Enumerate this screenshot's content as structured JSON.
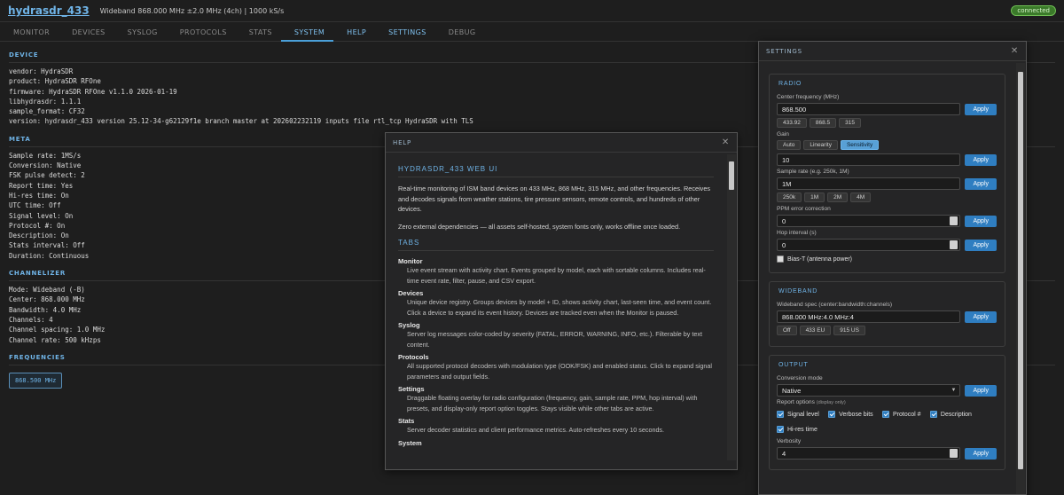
{
  "header": {
    "brand": "hydrasdr_433",
    "subtitle": "Wideband 868.000 MHz ±2.0 MHz (4ch) | 1000 kS/s",
    "status": "connected"
  },
  "tabs": [
    "MONITOR",
    "DEVICES",
    "SYSLOG",
    "PROTOCOLS",
    "STATS",
    "SYSTEM",
    "HELP",
    "SETTINGS",
    "DEBUG"
  ],
  "active_tab": "SYSTEM",
  "system": {
    "device_title": "DEVICE",
    "device": [
      "vendor: HydraSDR",
      "product: HydraSDR RFOne",
      "firmware: HydraSDR RFOne v1.1.0 2026-01-19",
      "libhydrasdr: 1.1.1",
      "sample_format: CF32",
      "version: hydrasdr_433 version 25.12-34-g62129f1e branch master at 202602232119 inputs file rtl_tcp HydraSDR with TLS"
    ],
    "meta_title": "META",
    "meta": [
      "Sample rate: 1MS/s",
      "Conversion: Native",
      "FSK pulse detect: 2",
      "Report time: Yes",
      "Hi-res time: On",
      "UTC time: Off",
      "Signal level: On",
      "Protocol #: On",
      "Description: On",
      "Stats interval: Off",
      "Duration: Continuous"
    ],
    "channelizer_title": "CHANNELIZER",
    "channelizer": [
      "Mode: Wideband (-B)",
      "Center: 868.000 MHz",
      "Bandwidth: 4.0 MHz",
      "Channels: 4",
      "Channel spacing: 1.0 MHz",
      "Channel rate: 500 kHzps"
    ],
    "frequencies_title": "FREQUENCIES",
    "frequency": "868.500 MHz"
  },
  "help": {
    "title": "HELP",
    "heading": "HYDRASDR_433 WEB UI",
    "intro": "Real-time monitoring of ISM band devices on 433 MHz, 868 MHz, 315 MHz, and other frequencies. Receives and decodes signals from weather stations, tire pressure sensors, remote controls, and hundreds of other devices.",
    "note": "Zero external dependencies — all assets self-hosted, system fonts only, works offline once loaded.",
    "tabs_heading": "TABS",
    "items": [
      {
        "term": "Monitor",
        "desc": "Live event stream with activity chart. Events grouped by model, each with sortable columns. Includes real-time event rate, filter, pause, and CSV export."
      },
      {
        "term": "Devices",
        "desc": "Unique device registry. Groups devices by model + ID, shows activity chart, last-seen time, and event count. Click a device to expand its event history. Devices are tracked even when the Monitor is paused."
      },
      {
        "term": "Syslog",
        "desc": "Server log messages color-coded by severity (FATAL, ERROR, WARNING, INFO, etc.). Filterable by text content."
      },
      {
        "term": "Protocols",
        "desc": "All supported protocol decoders with modulation type (OOK/FSK) and enabled status. Click to expand signal parameters and output fields."
      },
      {
        "term": "Settings",
        "desc": "Draggable floating overlay for radio configuration (frequency, gain, sample rate, PPM, hop interval) with presets, and display-only report option toggles. Stays visible while other tabs are active."
      },
      {
        "term": "Stats",
        "desc": "Server decoder statistics and client performance metrics. Auto-refreshes every 10 seconds."
      },
      {
        "term": "System",
        "desc": ""
      }
    ]
  },
  "settings": {
    "title": "SETTINGS",
    "radio": {
      "title": "RADIO",
      "center_label": "Center frequency (MHz)",
      "center_value": "868.500",
      "center_presets": [
        "433.92",
        "868.5",
        "315"
      ],
      "gain_label": "Gain",
      "gain_modes": [
        "Auto",
        "Linearity",
        "Sensitivity"
      ],
      "gain_active": "Sensitivity",
      "gain_value": "10",
      "sample_label": "Sample rate (e.g. 250k, 1M)",
      "sample_value": "1M",
      "sample_presets": [
        "250k",
        "1M",
        "2M",
        "4M"
      ],
      "ppm_label": "PPM error correction",
      "ppm_value": "0",
      "hop_label": "Hop interval (s)",
      "hop_value": "0",
      "bias_label": "Bias-T (antenna power)",
      "apply": "Apply"
    },
    "wideband": {
      "title": "WIDEBAND",
      "spec_label": "Wideband spec (center:bandwidth:channels)",
      "spec_value": "868.000 MHz:4.0 MHz:4",
      "presets": [
        "Off",
        "433 EU",
        "915 US"
      ]
    },
    "output": {
      "title": "OUTPUT",
      "conv_label": "Conversion mode",
      "conv_value": "Native",
      "report_label": "Report options",
      "report_note": "(display only)",
      "options": [
        "Signal level",
        "Verbose bits",
        "Protocol #",
        "Description",
        "Hi-res time"
      ],
      "verbosity_label": "Verbosity",
      "verbosity_value": "4"
    }
  },
  "colors": {
    "accent": "#6fb3e6",
    "button": "#2f7ec1",
    "status_green": "#3b7a2a"
  }
}
